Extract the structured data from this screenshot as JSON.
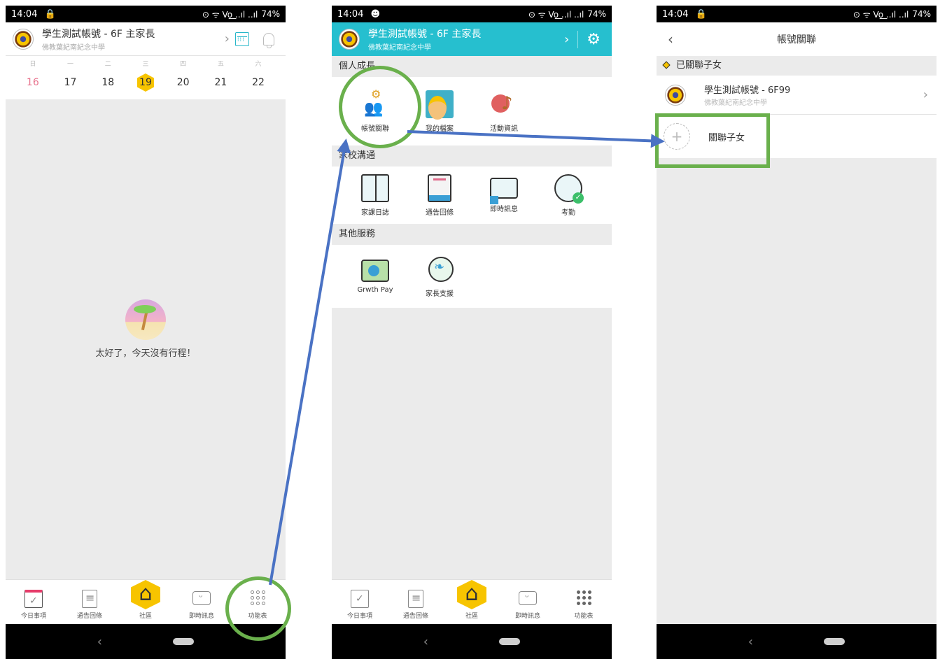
{
  "status": {
    "time": "14:04",
    "battery": "74%",
    "signal": "⊙ ᯤ Vo͟ ..ıl ..ıl"
  },
  "profile": {
    "name": "學生測試帳號 - 6F  主家長",
    "school": "佛教葉紀南紀念中學"
  },
  "week": {
    "labels": [
      "日",
      "一",
      "二",
      "三",
      "四",
      "五",
      "六"
    ],
    "dates": [
      "16",
      "17",
      "18",
      "19",
      "20",
      "21",
      "22"
    ]
  },
  "empty_message": "太好了，今天沒有行程！",
  "tabbar": {
    "today": "今日事項",
    "notices": "通告回條",
    "community": "社區",
    "messages": "即時訊息",
    "menu": "功能表"
  },
  "menu": {
    "personal_title": "個人成長",
    "personal_items": [
      "帳號關聯",
      "我的檔案",
      "活動資訊"
    ],
    "home_school_title": "家校溝通",
    "home_school_items": [
      "家課日誌",
      "通告回條",
      "即時訊息",
      "考勤"
    ],
    "other_title": "其他服務",
    "other_items": [
      "Grwth Pay",
      "家長支援"
    ]
  },
  "account_link": {
    "title": "帳號關聯",
    "section": "已關聯子女",
    "child_name": "學生測試帳號 - 6F99",
    "child_school": "佛教葉紀南紀念中學",
    "add_label": "關聯子女"
  },
  "colors": {
    "accent": "#26bfcf",
    "highlight": "#f7c400",
    "annotation": "#6ab04c",
    "arrow": "#4a72c4"
  }
}
